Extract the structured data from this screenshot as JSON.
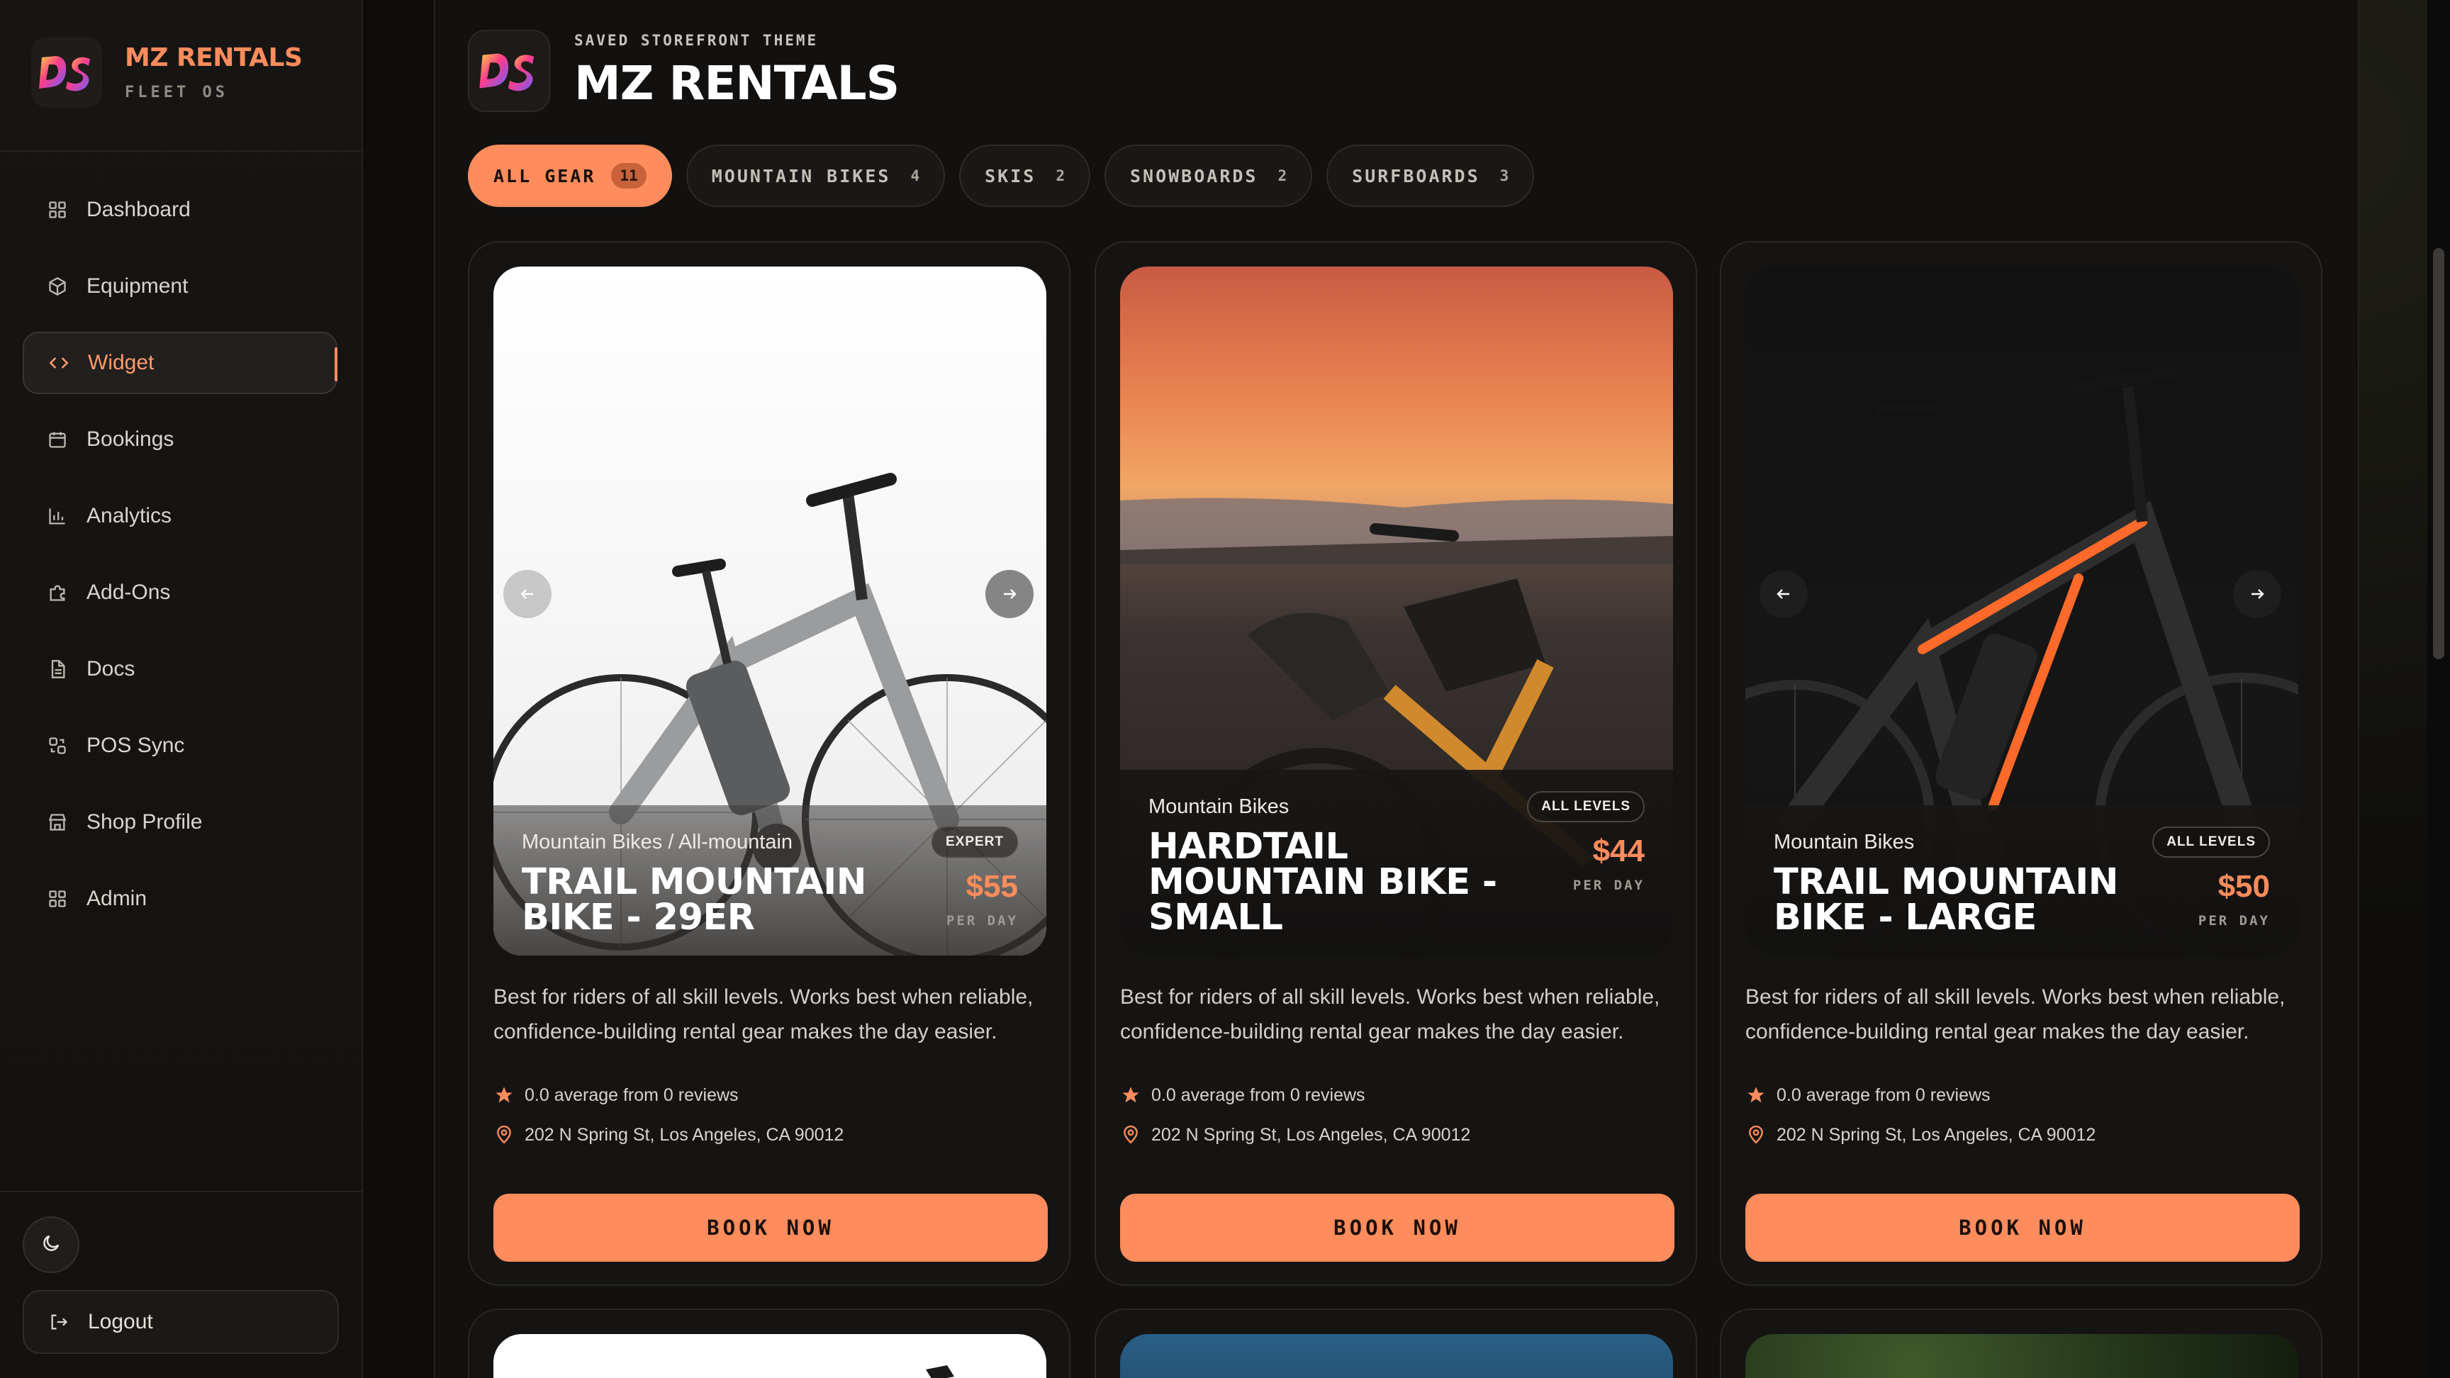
{
  "brand": {
    "name": "MZ RENTALS",
    "sub": "FLEET OS"
  },
  "nav": [
    {
      "label": "Dashboard",
      "icon": "grid-icon"
    },
    {
      "label": "Equipment",
      "icon": "box-icon"
    },
    {
      "label": "Widget",
      "icon": "code-icon",
      "active": true
    },
    {
      "label": "Bookings",
      "icon": "calendar-icon"
    },
    {
      "label": "Analytics",
      "icon": "bar-chart-icon"
    },
    {
      "label": "Add-Ons",
      "icon": "puzzle-icon"
    },
    {
      "label": "Docs",
      "icon": "document-icon"
    },
    {
      "label": "POS Sync",
      "icon": "sync-icon"
    },
    {
      "label": "Shop Profile",
      "icon": "store-icon"
    },
    {
      "label": "Admin",
      "icon": "grid-icon"
    }
  ],
  "logout_label": "Logout",
  "store": {
    "kicker": "SAVED STOREFRONT THEME",
    "title": "MZ RENTALS"
  },
  "tabs": [
    {
      "label": "ALL GEAR",
      "count": "11",
      "active": true
    },
    {
      "label": "MOUNTAIN BIKES",
      "count": "4"
    },
    {
      "label": "SKIS",
      "count": "2"
    },
    {
      "label": "SNOWBOARDS",
      "count": "2"
    },
    {
      "label": "SURFBOARDS",
      "count": "3"
    }
  ],
  "cards": [
    {
      "category": "Mountain Bikes / All-mountain",
      "level": "EXPERT",
      "title": "TRAIL MOUNTAIN BIKE - 29ER",
      "price": "$55",
      "per_day": "PER DAY",
      "description": "Best for riders of all skill levels. Works best when reliable, confidence-building rental gear makes the day easier.",
      "rating": "0.0 average from 0 reviews",
      "location": "202 N Spring St, Los Angeles, CA 90012",
      "button": "BOOK NOW"
    },
    {
      "category": "Mountain Bikes",
      "level": "ALL LEVELS",
      "title": "HARDTAIL MOUNTAIN BIKE - SMALL",
      "price": "$44",
      "per_day": "PER DAY",
      "description": "Best for riders of all skill levels. Works best when reliable, confidence-building rental gear makes the day easier.",
      "rating": "0.0 average from 0 reviews",
      "location": "202 N Spring St, Los Angeles, CA 90012",
      "button": "BOOK NOW"
    },
    {
      "category": "Mountain Bikes",
      "level": "ALL LEVELS",
      "title": "TRAIL MOUNTAIN BIKE - LARGE",
      "price": "$50",
      "per_day": "PER DAY",
      "description": "Best for riders of all skill levels. Works best when reliable, confidence-building rental gear makes the day easier.",
      "rating": "0.0 average from 0 reviews",
      "location": "202 N Spring St, Los Angeles, CA 90012",
      "button": "BOOK NOW"
    }
  ],
  "colors": {
    "accent": "#ff8c5c",
    "background": "#121110",
    "sidebar": "#171513"
  }
}
